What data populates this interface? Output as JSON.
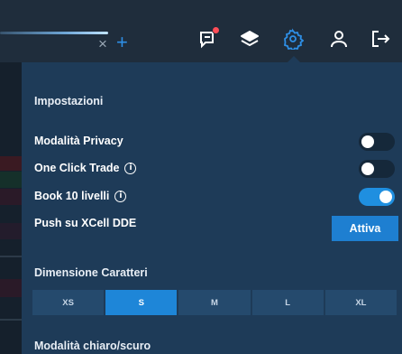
{
  "topbar": {
    "search_clear_symbol": "×",
    "add_symbol": "+",
    "icons": [
      "messages-icon",
      "layers-icon",
      "settings-icon",
      "user-icon",
      "logout-icon"
    ]
  },
  "settings": {
    "title": "Impostazioni",
    "privacy_label": "Modalità Privacy",
    "privacy_enabled": false,
    "one_click_label": "One Click Trade",
    "one_click_enabled": false,
    "book_label": "Book 10 livelli",
    "book_enabled": true,
    "push_label": "Push su XCell DDE",
    "push_button": "Attiva",
    "font_size_title": "Dimensione Caratteri",
    "font_sizes": [
      "XS",
      "S",
      "M",
      "L",
      "XL"
    ],
    "selected_font_size": "S",
    "theme_title": "Modalità chiaro/scuro"
  },
  "colors": {
    "accent": "#1e86d8",
    "panel": "#1e3b58",
    "topbar": "#1f2d3c",
    "notification": "#ff4d57"
  }
}
